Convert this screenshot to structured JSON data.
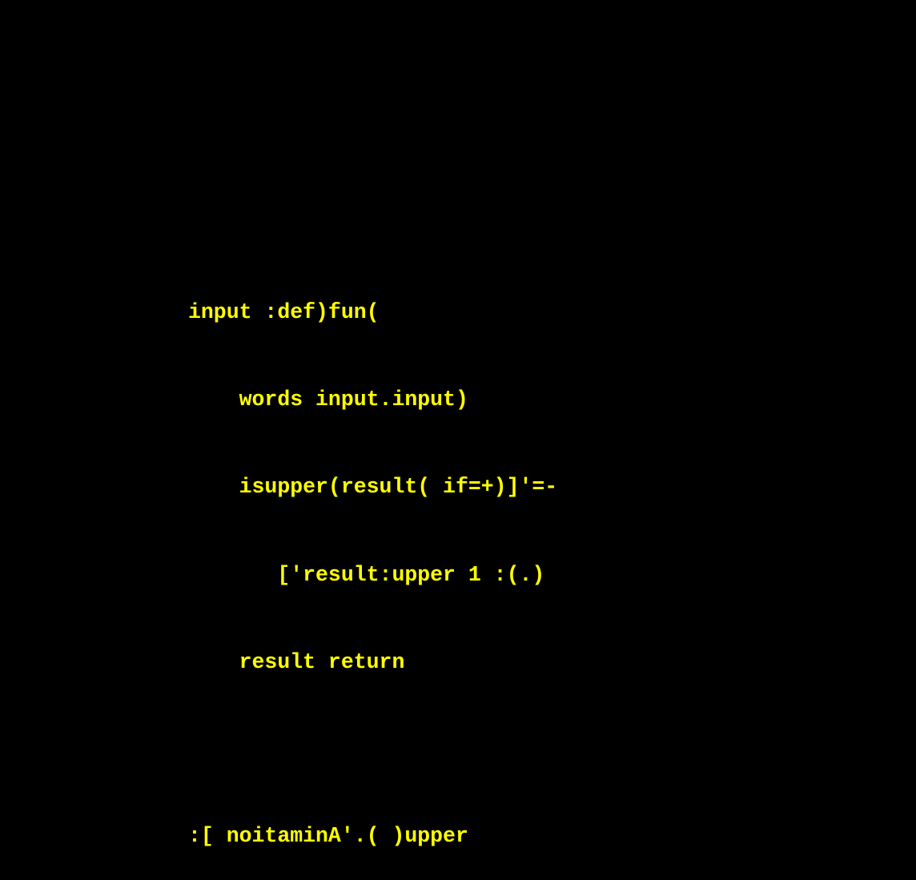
{
  "code": {
    "color": "#ffff00",
    "background": "#000000",
    "lines": [
      "input :def)fun(",
      "    words input.input)",
      "    isupper(result( if=+)]'=-",
      "       ['result:upper 1 :(.)",
      "    result return",
      "",
      ":[ noitaminA'.( )upper"
    ]
  }
}
